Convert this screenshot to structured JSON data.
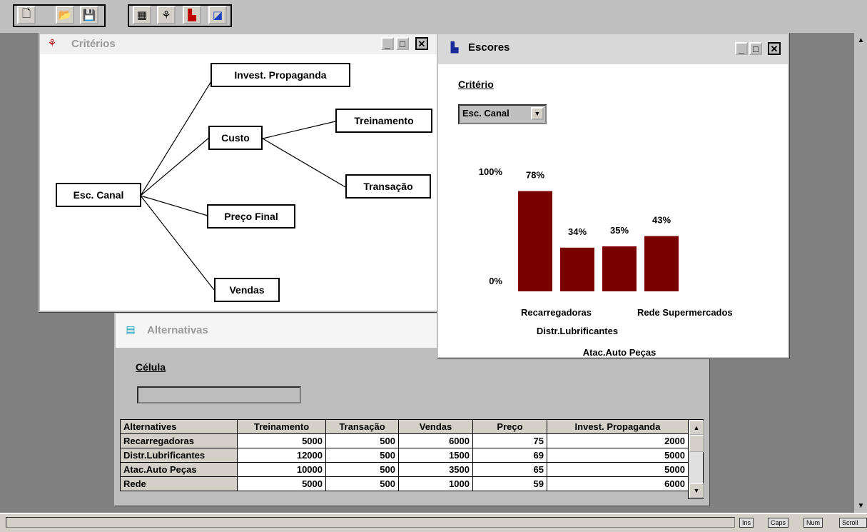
{
  "toolbar": {
    "buttons": [
      {
        "icon": "new-document-icon",
        "glyph": "🗋"
      },
      {
        "icon": "open-folder-icon",
        "glyph": "📂"
      },
      {
        "icon": "save-icon",
        "glyph": "💾"
      },
      {
        "icon": "grid-icon",
        "glyph": "▦"
      },
      {
        "icon": "tree-icon",
        "glyph": "⚘"
      },
      {
        "icon": "bar-chart-icon",
        "glyph": "▙"
      },
      {
        "icon": "line-chart-icon",
        "glyph": "◪"
      }
    ]
  },
  "criterios": {
    "title": "Critérios",
    "nodes": {
      "root": "Esc. Canal",
      "invest": "Invest. Propaganda",
      "custo": "Custo",
      "treinamento": "Treinamento",
      "transacao": "Transação",
      "preco": "Preço Final",
      "vendas": "Vendas"
    }
  },
  "escores": {
    "title": "Escores",
    "criterio_label": "Critério",
    "criterio_value": "Esc. Canal",
    "accent": "#7a0000"
  },
  "chart_data": {
    "type": "bar",
    "categories": [
      "Recarregadoras",
      "Distr.Lubrificantes",
      "Atac.Auto Peças",
      "Rede Supermercados"
    ],
    "values": [
      78,
      34,
      35,
      43
    ],
    "value_labels": [
      "78%",
      "34%",
      "35%",
      "43%"
    ],
    "y_labels": {
      "top": "100%",
      "bottom": "0%"
    },
    "ylim": [
      0,
      100
    ]
  },
  "alternativas": {
    "title": "Alternativas",
    "celula_label": "Célula",
    "celula_value": "",
    "columns": [
      "Alternatives",
      "Treinamento",
      "Transação",
      "Vendas",
      "Preço",
      "Invest. Propaganda"
    ],
    "rows": [
      [
        "Recarregadoras",
        "5000",
        "500",
        "6000",
        "75",
        "2000"
      ],
      [
        "Distr.Lubrificantes",
        "12000",
        "500",
        "1500",
        "69",
        "5000"
      ],
      [
        "Atac.Auto Peças",
        "10000",
        "500",
        "3500",
        "65",
        "5000"
      ],
      [
        "Rede",
        "5000",
        "500",
        "1000",
        "59",
        "6000"
      ]
    ]
  },
  "statusbar": {
    "indicators": [
      "Ins",
      "Caps",
      "Num",
      "Scroll"
    ]
  }
}
